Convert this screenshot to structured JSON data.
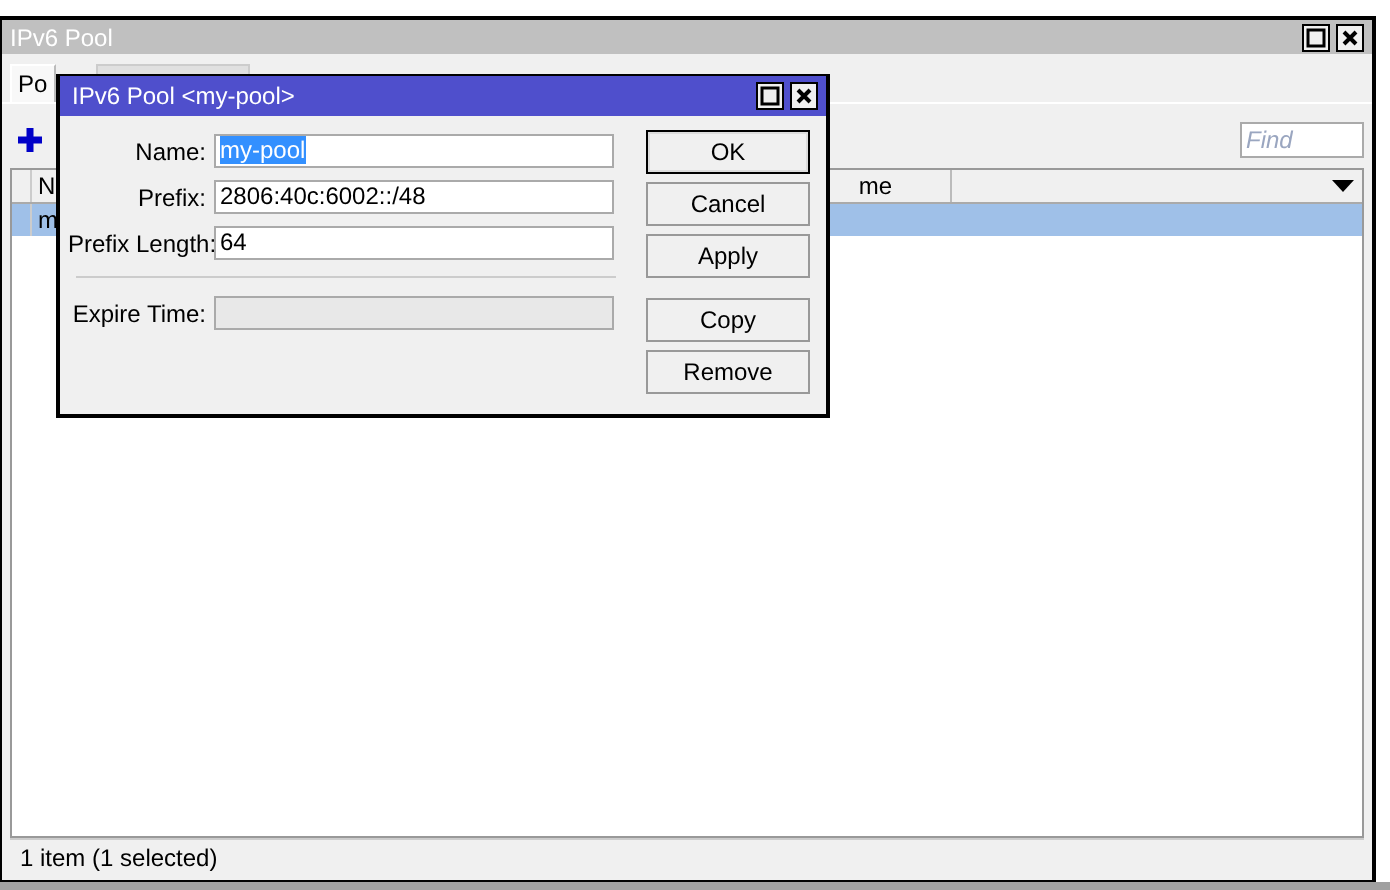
{
  "window": {
    "title": "IPv6 Pool"
  },
  "tabs": [
    {
      "label": "Po",
      "selected": true
    },
    {
      "selected": false
    }
  ],
  "toolbar": {
    "search": {
      "placeholder": "Find"
    }
  },
  "table": {
    "columns": [
      "N",
      "me"
    ],
    "rows": [
      {
        "cells": [
          "m"
        ],
        "selected": true
      }
    ]
  },
  "status_bar": "1 item (1 selected)",
  "dialog": {
    "title": "IPv6 Pool <my-pool>",
    "fields": [
      {
        "label": "Name:",
        "value": "my-pool",
        "highlighted": true,
        "disabled": false
      },
      {
        "label": "Prefix:",
        "value": "2806:40c:6002::/48",
        "highlighted": false,
        "disabled": false
      },
      {
        "label": "Prefix Length:",
        "value": "64",
        "highlighted": false,
        "disabled": false
      },
      {
        "label": "Expire Time:",
        "disabled": true,
        "separated": true
      }
    ],
    "button_groups": [
      [
        {
          "label": "OK",
          "focused": true
        },
        {
          "label": "Cancel",
          "focused": false
        },
        {
          "label": "Apply",
          "focused": false
        }
      ],
      [
        {
          "label": "Copy",
          "focused": false
        },
        {
          "label": "Remove",
          "focused": false
        }
      ]
    ]
  }
}
